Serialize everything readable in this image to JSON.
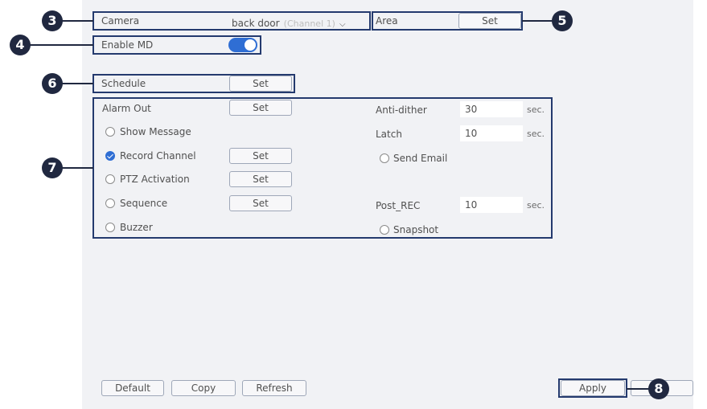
{
  "camera": {
    "label": "Camera",
    "value": "back door",
    "channel": "(Channel 1)"
  },
  "area": {
    "label": "Area",
    "button": "Set"
  },
  "enable_md": {
    "label": "Enable MD",
    "enabled": true
  },
  "schedule": {
    "label": "Schedule",
    "button": "Set"
  },
  "alarm_out": {
    "label": "Alarm Out",
    "button": "Set"
  },
  "show_message": {
    "label": "Show Message",
    "checked": false
  },
  "record_channel": {
    "label": "Record Channel",
    "checked": true,
    "button": "Set"
  },
  "ptz_activation": {
    "label": "PTZ Activation",
    "checked": false,
    "button": "Set"
  },
  "sequence": {
    "label": "Sequence",
    "checked": false,
    "button": "Set"
  },
  "buzzer": {
    "label": "Buzzer",
    "checked": false
  },
  "anti_dither": {
    "label": "Anti-dither",
    "value": "30",
    "unit": "sec."
  },
  "latch": {
    "label": "Latch",
    "value": "10",
    "unit": "sec."
  },
  "send_email": {
    "label": "Send Email",
    "checked": false
  },
  "post_rec": {
    "label": "Post_REC",
    "value": "10",
    "unit": "sec."
  },
  "snapshot": {
    "label": "Snapshot",
    "checked": false
  },
  "footer": {
    "default": "Default",
    "copy": "Copy",
    "refresh": "Refresh",
    "apply": "Apply"
  },
  "callouts": {
    "c3": "3",
    "c4": "4",
    "c5": "5",
    "c6": "6",
    "c7": "7",
    "c8": "8"
  },
  "colors": {
    "accent": "#2f6ed4",
    "callout": "#202840",
    "highlight": "#243a6e",
    "panel": "#f1f2f5"
  }
}
